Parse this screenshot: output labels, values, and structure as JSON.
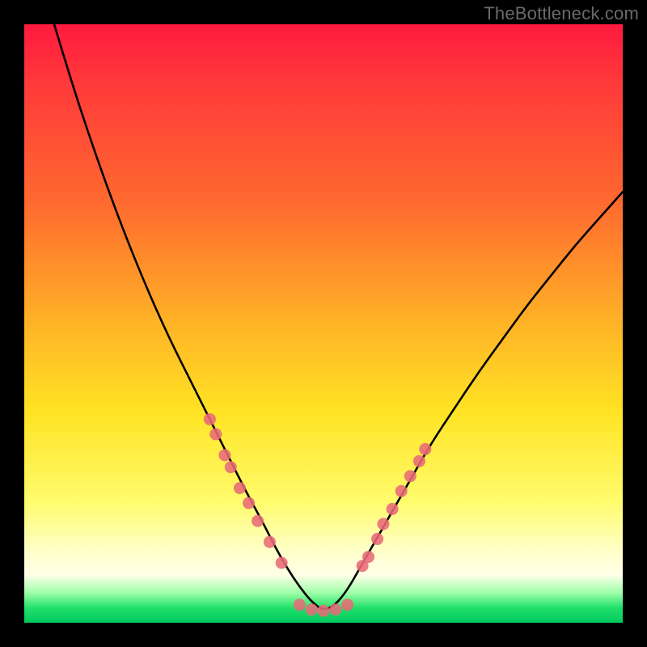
{
  "watermark": "TheBottleneck.com",
  "chart_data": {
    "type": "line",
    "title": "",
    "xlabel": "",
    "ylabel": "",
    "xlim": [
      0,
      100
    ],
    "ylim": [
      0,
      100
    ],
    "grid": false,
    "legend": false,
    "series": [
      {
        "name": "bottleneck-curve",
        "color": "#000000",
        "x": [
          5,
          8,
          12,
          16,
          20,
          24,
          28,
          31,
          34,
          37,
          40,
          42,
          44,
          46,
          48,
          50,
          52,
          54,
          56,
          60,
          64,
          68,
          72,
          76,
          80,
          84,
          88,
          92,
          96,
          100
        ],
        "y": [
          100,
          90,
          78,
          67,
          57,
          48,
          40,
          34,
          28,
          22,
          16.5,
          12.5,
          9,
          6,
          3.5,
          2,
          3,
          5.5,
          9,
          16,
          23,
          30,
          36,
          42,
          47.5,
          53,
          58,
          63,
          67.5,
          72
        ]
      }
    ],
    "markers": [
      {
        "name": "left-cluster",
        "color": "#e86a77",
        "points": [
          {
            "x": 31.0,
            "y": 34.0
          },
          {
            "x": 32.0,
            "y": 31.5
          },
          {
            "x": 33.5,
            "y": 28.0
          },
          {
            "x": 34.5,
            "y": 26.0
          },
          {
            "x": 36.0,
            "y": 22.5
          },
          {
            "x": 37.5,
            "y": 20.0
          },
          {
            "x": 39.0,
            "y": 17.0
          },
          {
            "x": 41.0,
            "y": 13.5
          },
          {
            "x": 43.0,
            "y": 10.0
          }
        ]
      },
      {
        "name": "bottom-cluster",
        "color": "#e86a77",
        "points": [
          {
            "x": 46.0,
            "y": 3.0
          },
          {
            "x": 48.0,
            "y": 2.2
          },
          {
            "x": 50.0,
            "y": 2.0
          },
          {
            "x": 52.0,
            "y": 2.2
          },
          {
            "x": 54.0,
            "y": 3.0
          }
        ]
      },
      {
        "name": "right-cluster",
        "color": "#e86a77",
        "points": [
          {
            "x": 56.5,
            "y": 9.5
          },
          {
            "x": 57.5,
            "y": 11.0
          },
          {
            "x": 59.0,
            "y": 14.0
          },
          {
            "x": 60.0,
            "y": 16.5
          },
          {
            "x": 61.5,
            "y": 19.0
          },
          {
            "x": 63.0,
            "y": 22.0
          },
          {
            "x": 64.5,
            "y": 24.5
          },
          {
            "x": 66.0,
            "y": 27.0
          },
          {
            "x": 67.0,
            "y": 29.0
          }
        ]
      }
    ]
  }
}
